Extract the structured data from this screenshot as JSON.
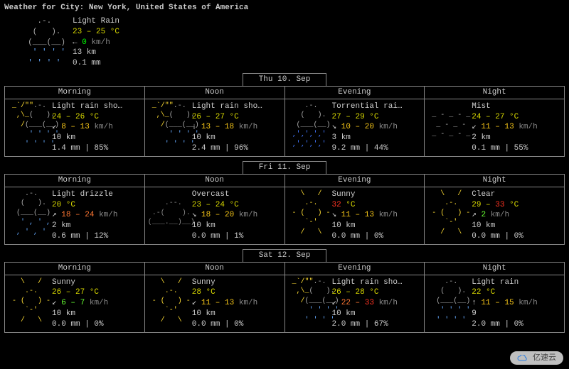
{
  "title": "Weather for City: New York, United States of America",
  "current": {
    "art": "rain-light",
    "cond": "Light Rain",
    "temp": "23 – 25 °C",
    "wind_arrow": "←",
    "wind": "0",
    "wind_class": "wind-zero",
    "wind_unit": "km/h",
    "vis": "13 km",
    "precip": "0.1 mm"
  },
  "part_labels": [
    "Morning",
    "Noon",
    "Evening",
    "Night"
  ],
  "days": [
    {
      "label": "Thu 10. Sep",
      "parts": [
        {
          "art": "rain-shower",
          "cond": "Light rain sho…",
          "temp": "24 – 26 °C",
          "wind_arrow": "↙",
          "wind": "8 – 13",
          "wind_class": "wind-med",
          "wind_unit": "km/h",
          "vis": "10 km",
          "precip": "1.4 mm | 85%"
        },
        {
          "art": "rain-shower",
          "cond": "Light rain sho…",
          "temp": "26 – 27 °C",
          "wind_arrow": "↓",
          "wind": "13 – 18",
          "wind_class": "wind-med",
          "wind_unit": "km/h",
          "vis": "10 km",
          "precip": "2.4 mm | 96%"
        },
        {
          "art": "storm",
          "cond": "Torrential rai…",
          "temp": "27 – 29 °C",
          "wind_arrow": "↘",
          "wind": "10 – 20",
          "wind_class": "wind-med",
          "wind_unit": "km/h",
          "vis": "3 km",
          "precip": "9.2 mm | 44%"
        },
        {
          "art": "mist",
          "cond": "Mist",
          "temp": "24 – 27 °C",
          "wind_arrow": "↙",
          "wind": "11 – 13",
          "wind_class": "wind-med",
          "wind_unit": "km/h",
          "vis": "2 km",
          "precip": "0.1 mm | 55%"
        }
      ]
    },
    {
      "label": "Fri 11. Sep",
      "parts": [
        {
          "art": "drizzle",
          "cond": "Light drizzle",
          "temp": "20 °C",
          "wind_arrow": "↗",
          "wind": "18 – 24",
          "wind_class": "wind-high",
          "wind_unit": "km/h",
          "vis": "2 km",
          "precip": "0.6 mm | 12%"
        },
        {
          "art": "overcast",
          "cond": "Overcast",
          "temp": "23 – 24 °C",
          "wind_arrow": "↘",
          "wind": "18 – 20",
          "wind_class": "wind-med",
          "wind_unit": "km/h",
          "vis": "10 km",
          "precip": "0.0 mm | 1%"
        },
        {
          "art": "sunny",
          "cond": "Sunny",
          "temp_red": "32",
          "temp_unit": " °C",
          "wind_arrow": "↘",
          "wind": "11 – 13",
          "wind_class": "wind-med",
          "wind_unit": "km/h",
          "vis": "10 km",
          "precip": "0.0 mm | 0%"
        },
        {
          "art": "clear-night",
          "cond": "Clear",
          "temp_mix_a": "29 – ",
          "temp_red": "33",
          "temp_unit": " °C",
          "wind_arrow": "↗",
          "wind": "2",
          "wind_class": "wind-low",
          "wind_unit": "km/h",
          "vis": "10 km",
          "precip": "0.0 mm | 0%"
        }
      ]
    },
    {
      "label": "Sat 12. Sep",
      "parts": [
        {
          "art": "sunny",
          "cond": "Sunny",
          "temp": "26 – 27 °C",
          "wind_arrow": "↙",
          "wind": "6 – 7",
          "wind_class": "wind-low",
          "wind_unit": "km/h",
          "vis": "10 km",
          "precip": "0.0 mm | 0%"
        },
        {
          "art": "sunny",
          "cond": "Sunny",
          "temp": "28 °C",
          "wind_arrow": "↙",
          "wind": "11 – 13",
          "wind_class": "wind-med",
          "wind_unit": "km/h",
          "vis": "10 km",
          "precip": "0.0 mm | 0%"
        },
        {
          "art": "rain-shower",
          "cond": "Light rain sho…",
          "temp": "26 – 28 °C",
          "wind_arrow": "↙",
          "wind_mix_a": "22 – ",
          "wind_red": "33",
          "wind_unit": "km/h",
          "vis": "10 km",
          "precip": "2.0 mm | 67%"
        },
        {
          "art": "rain-light",
          "cond": "Light rain",
          "temp": "22 °C",
          "wind_arrow": "↑",
          "wind": "11 – 15",
          "wind_class": "wind-med",
          "wind_unit": "km/h",
          "vis": "9",
          "precip": "2.0 mm | 0%"
        }
      ]
    }
  ],
  "watermark": "亿速云"
}
